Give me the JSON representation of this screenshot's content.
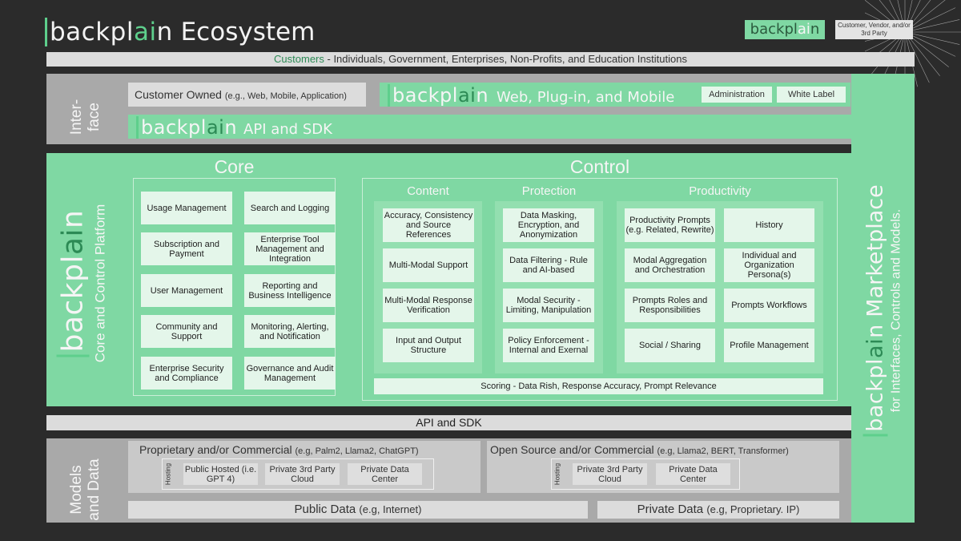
{
  "brand": {
    "name_pre": "backpl",
    "name_ai": "ai",
    "name_post": "n"
  },
  "header": {
    "title_suffix": "Ecosystem",
    "legend_party": "Customer, Vendor, and/or 3rd Party"
  },
  "customers": {
    "label": "Customers",
    "text": " - Individuals, Government, Enterprises, Non-Profits, and Education Institutions"
  },
  "interface": {
    "label_line1": "Inter-",
    "label_line2": "face",
    "customer_owned": "Customer Owned",
    "customer_owned_eg": "(e.g., Web, Mobile, Application)",
    "web_label": "Web, Plug-in, and Mobile",
    "administration": "Administration",
    "white_label": "White Label",
    "api_label": "API and SDK"
  },
  "marketplace": {
    "title": "Marketplace",
    "subtitle": "for Interfaces, Controls and Models."
  },
  "platform": {
    "subtitle": "Core and Control Platform",
    "core_title": "Core",
    "control_title": "Control",
    "core_items": [
      "Usage Management",
      "Search and Logging",
      "Subscription and Payment",
      "Enterprise Tool Management and Integration",
      "User Management",
      "Reporting and Business Intelligence",
      "Community and Support",
      "Monitoring, Alerting, and Notification",
      "Enterprise Security and Compliance",
      "Governance and Audit Management"
    ],
    "content_title": "Content",
    "content_items": [
      "Accuracy, Consistency and Source References",
      "Multi-Modal Support",
      "Multi-Modal Response Verification",
      "Input and Output Structure"
    ],
    "protection_title": "Protection",
    "protection_items": [
      "Data Masking, Encryption, and Anonymization",
      "Data Filtering - Rule and AI-based",
      "Modal Security - Limiting, Manipulation",
      "Policy Enforcement - Internal and Exernal"
    ],
    "productivity_title": "Productivity",
    "productivity_items": [
      "Productivity Prompts (e.g. Related, Rewrite)",
      "History",
      "Modal Aggregation and Orchestration",
      "Individual and Organization Persona(s)",
      "Prompts Roles and Responsibilities",
      "Prompts Workflows",
      "Social / Sharing",
      "Profile Management"
    ],
    "scoring": "Scoring - Data Rish, Response Accuracy, Prompt Relevance"
  },
  "api_sdk": "API and SDK",
  "models": {
    "label_line1": "Models",
    "label_line2": "and Data",
    "proprietary_title": "Proprietary and/or Commercial",
    "proprietary_eg": "(e.g, Palm2, Llama2, ChatGPT)",
    "open_title": "Open Source and/or Commercial",
    "open_eg": "(e.g, Llama2, BERT, Transformer)",
    "hosting_label": "Hosting",
    "prop_hosting": [
      "Public Hosted (i.e. GPT 4)",
      "Private 3rd Party Cloud",
      "Private Data Center"
    ],
    "open_hosting": [
      "Private 3rd Party Cloud",
      "Private Data Center"
    ],
    "public_data": "Public Data",
    "public_data_eg": "(e.g, Internet)",
    "private_data": "Private Data",
    "private_data_eg": "(e.g, Proprietary. IP)"
  },
  "colors": {
    "background": "#2b2b2b",
    "green": "#7fd8a3",
    "accent": "#5ecf8c",
    "light": "#e4f6ea",
    "gray": "#a9a9a9"
  }
}
